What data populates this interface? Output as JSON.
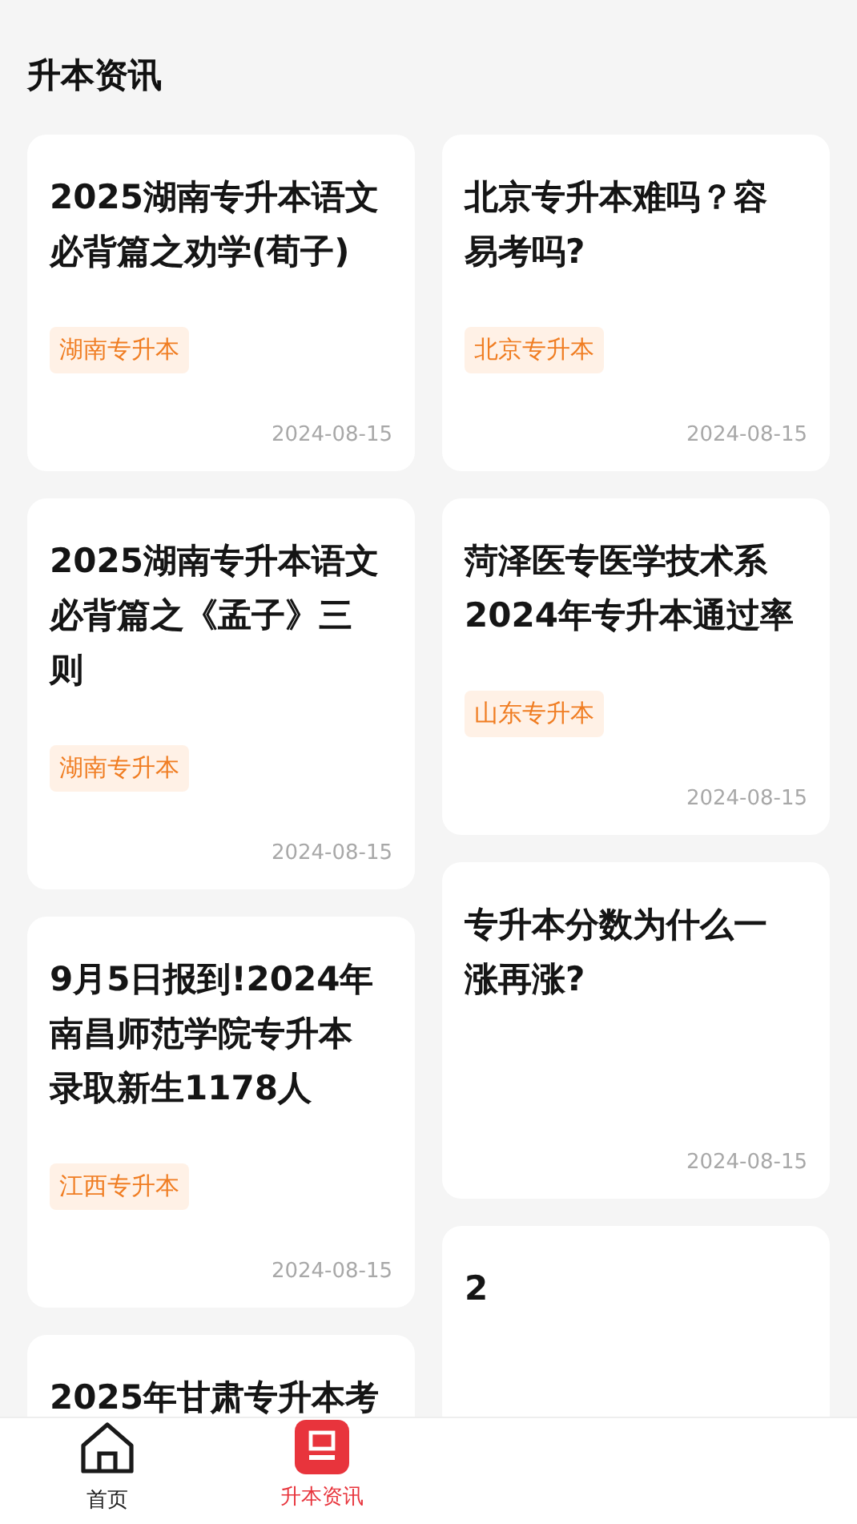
{
  "header": {
    "title": "升本资讯"
  },
  "columns": [
    {
      "cards": [
        {
          "title": "2025湖南专升本语文必背篇之劝学(荀子)",
          "tag": "湖南专升本",
          "date": "2024-08-15"
        },
        {
          "title": "2025湖南专升本语文必背篇之《孟子》三则",
          "tag": "湖南专升本",
          "date": "2024-08-15"
        },
        {
          "title": "9月5日报到!2024年南昌师范学院专升本录取新生1178人",
          "tag": "江西专升本",
          "date": "2024-08-15"
        },
        {
          "title": "2025年甘肃专升本考"
        }
      ]
    },
    {
      "cards": [
        {
          "title": "北京专升本难吗？容易考吗?",
          "tag": "北京专升本",
          "date": "2024-08-15"
        },
        {
          "title": "菏泽医专医学技术系2024年专升本通过率",
          "tag": "山东专升本",
          "date": "2024-08-15"
        },
        {
          "title": "专升本分数为什么一涨再涨?",
          "date": "2024-08-15"
        },
        {
          "title": "2"
        }
      ]
    }
  ],
  "tab_bar": [
    {
      "kind": "home",
      "label": "首页",
      "selected": false
    },
    {
      "kind": "news",
      "label": "升本资讯",
      "selected": true
    }
  ]
}
